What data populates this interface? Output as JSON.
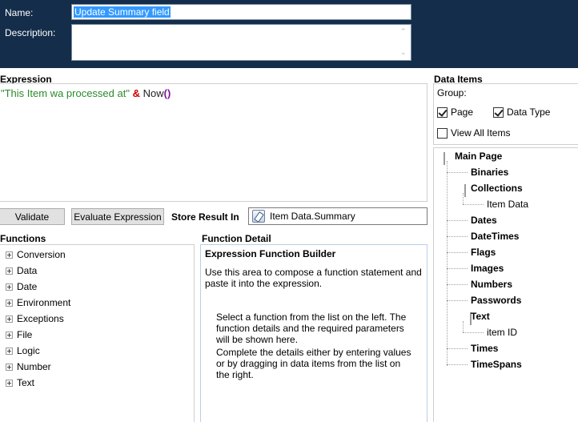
{
  "header": {
    "name_label": "Name:",
    "name_value": "Update Summary field",
    "description_label": "Description:",
    "description_value": ""
  },
  "expression": {
    "title": "Expression",
    "string_literal": "\"This Item wa processed at\"",
    "operator": "&",
    "function_name": "Now",
    "parens": "()"
  },
  "actions": {
    "validate_label": "Validate",
    "evaluate_label": "Evaluate Expression",
    "store_result_label": "Store Result In",
    "store_result_value": "Item Data.Summary"
  },
  "functions": {
    "title": "Functions",
    "items": [
      "Conversion",
      "Data",
      "Date",
      "Environment",
      "Exceptions",
      "File",
      "Logic",
      "Number",
      "Text"
    ]
  },
  "function_detail": {
    "title": "Function Detail",
    "heading": "Expression Function Builder",
    "intro": "Use this area to compose a function statement and paste it into the expression.",
    "para1": "Select a function from the list on the left. The function details and the required parameters will be shown here.",
    "para2": "Complete the details either by entering values or by dragging in data items from the list on the right."
  },
  "data_items": {
    "title": "Data Items",
    "group_label": "Group:",
    "page_label": "Page",
    "page_checked": true,
    "data_type_label": "Data Type",
    "data_type_checked": true,
    "view_all_label": "View All Items",
    "view_all_checked": false,
    "tree": {
      "root": "Main Page",
      "binaries": "Binaries",
      "collections": "Collections",
      "item_data": "Item Data",
      "dates": "Dates",
      "datetimes": "DateTimes",
      "flags": "Flags",
      "images": "Images",
      "numbers": "Numbers",
      "passwords": "Passwords",
      "text": "Text",
      "item_id": "item ID",
      "times": "Times",
      "timespans": "TimeSpans"
    }
  }
}
